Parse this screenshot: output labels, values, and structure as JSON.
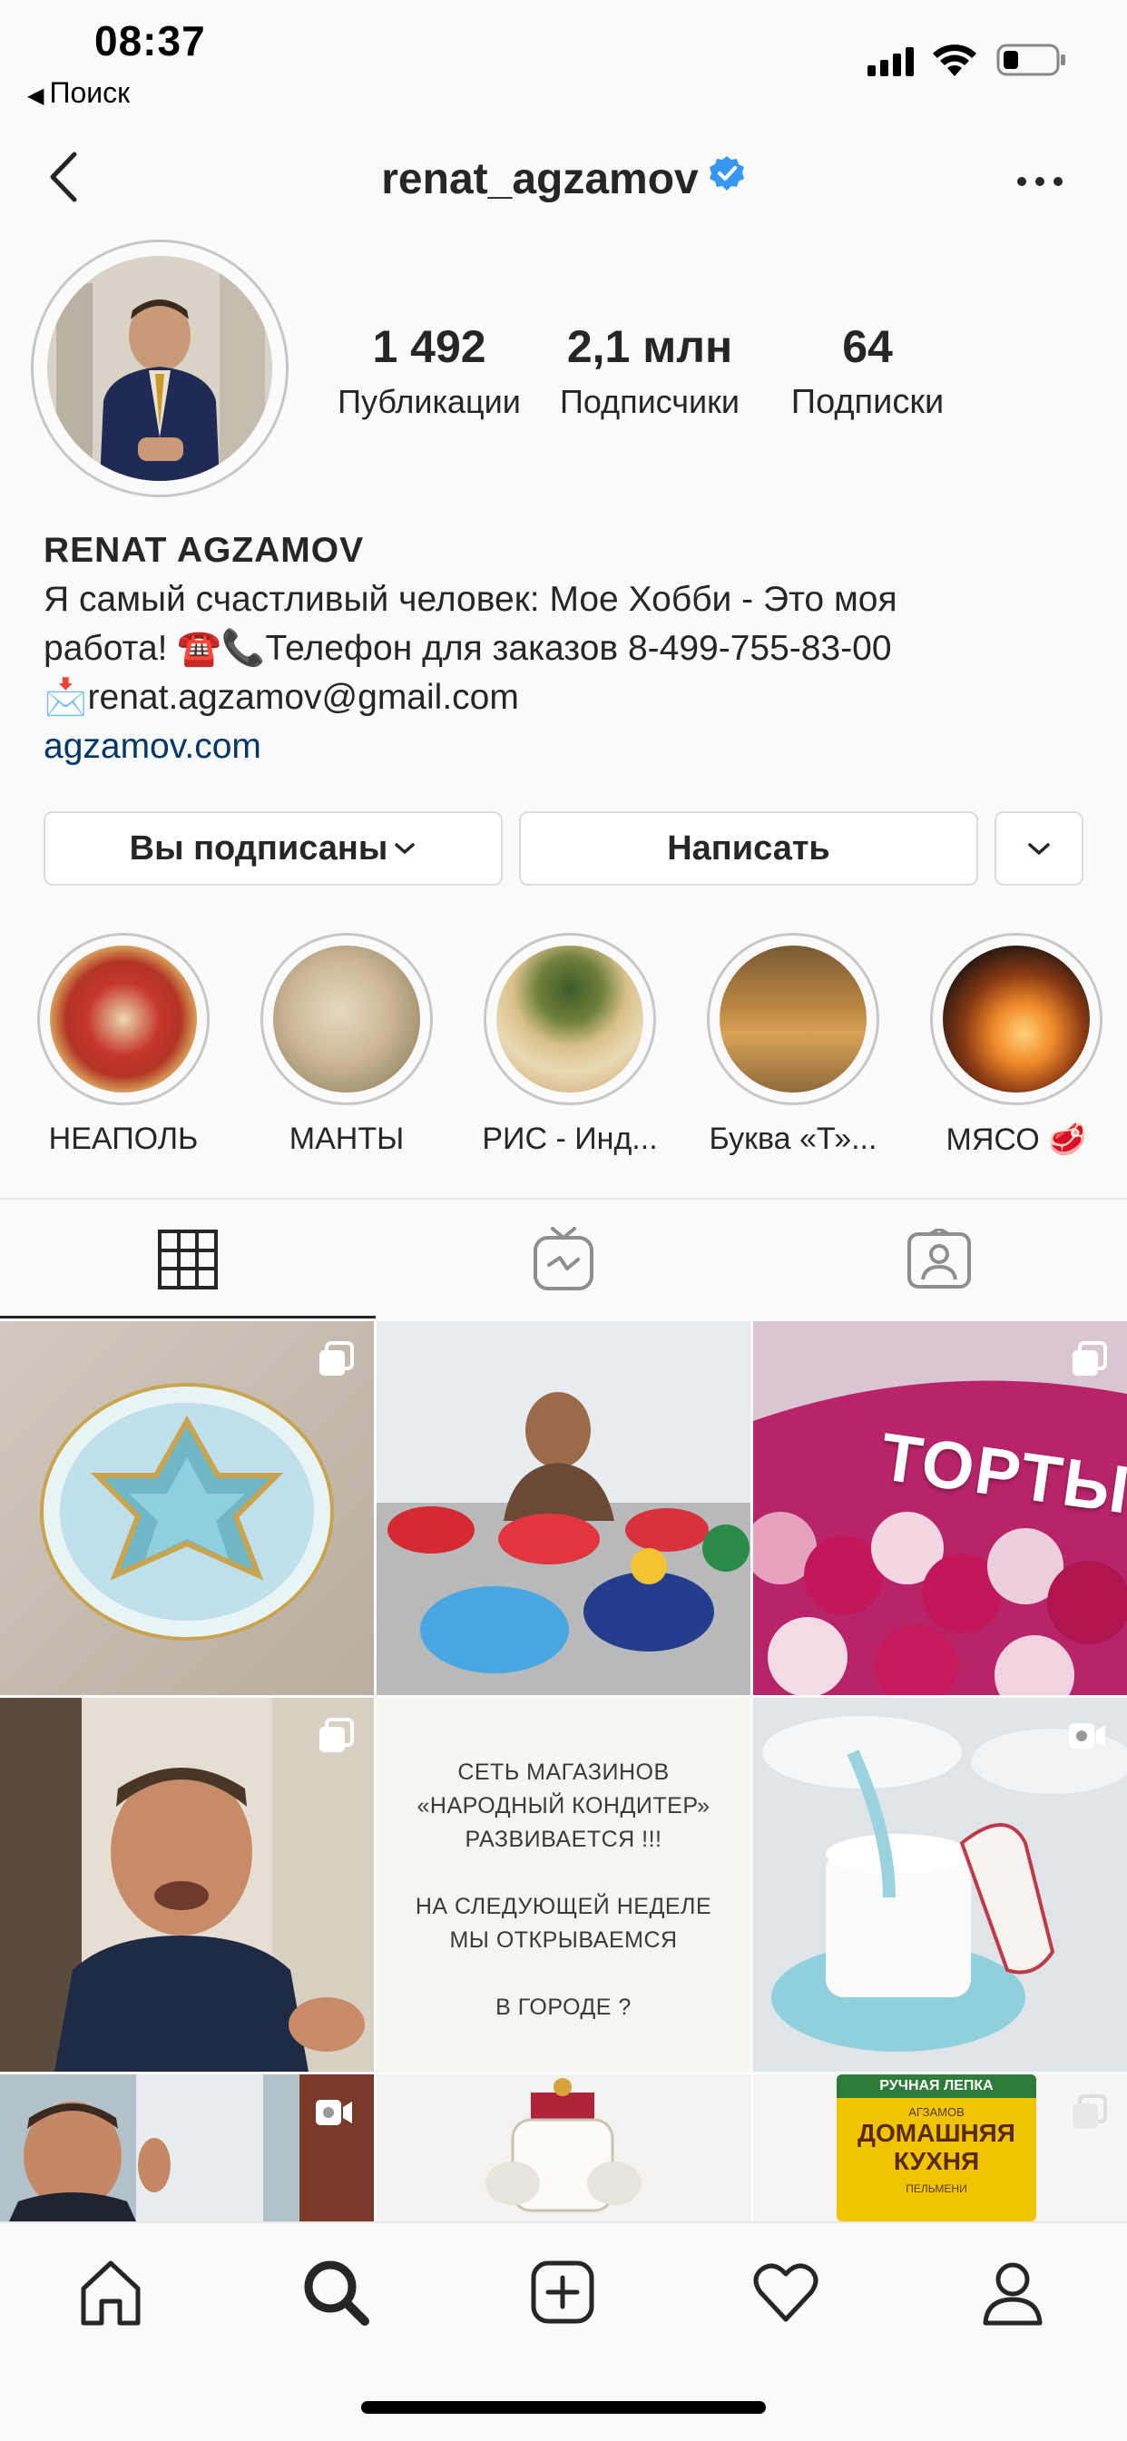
{
  "status_bar": {
    "time": "08:37",
    "back_label": "Поиск"
  },
  "header": {
    "username": "renat_agzamov",
    "verified_icon": "verified-badge-icon",
    "more_icon": "more-horizontal-icon",
    "back_icon": "chevron-left-icon"
  },
  "profile": {
    "stats": [
      {
        "value": "1 492",
        "label": "Публикации"
      },
      {
        "value": "2,1 млн",
        "label": "Подписчики"
      },
      {
        "value": "64",
        "label": "Подписки"
      }
    ],
    "name": "RENAT AGZAMOV",
    "bio_line1": "Я самый счастливый человек: Мое Хобби - Это моя",
    "bio_line2": "работа! ☎️📞Телефон для заказов 8-499-755-83-00",
    "bio_line3": "📩renat.agzamov@gmail.com",
    "website": "agzamov.com"
  },
  "actions": {
    "following_label": "Вы подписаны",
    "message_label": "Написать"
  },
  "highlights": [
    {
      "label": "НЕАПОЛЬ"
    },
    {
      "label": "МАНТЫ"
    },
    {
      "label": "РИС - Инд..."
    },
    {
      "label": "Буква «Т»..."
    },
    {
      "label": "МЯСО 🥩"
    }
  ],
  "tabs": [
    {
      "name": "grid",
      "icon": "grid-icon"
    },
    {
      "name": "igtv",
      "icon": "igtv-icon"
    },
    {
      "name": "tagged",
      "icon": "tagged-person-icon"
    }
  ],
  "posts": {
    "text_post": "СЕТЬ МАГАЗИНОВ\n«НАРОДНЫЙ КОНДИТЕР»\nРАЗВИВАЕТСЯ !!!\n\nНА СЛЕДУЮЩЕЙ НЕДЕЛЕ\nМЫ ОТКРЫВАЕМСЯ\n\nВ ГОРОДЕ ?",
    "sign_text": "ТОРТЫ",
    "package_top": "РУЧНАЯ ЛЕПКА",
    "package_brand": "АГЗАМОВ",
    "package_title1": "ДОМАШНЯЯ",
    "package_title2": "КУХНЯ",
    "package_bottom": "ПЕЛЬМЕНИ"
  },
  "bottom_nav": [
    "home-icon",
    "search-icon",
    "new-post-icon",
    "activity-heart-icon",
    "profile-icon"
  ]
}
